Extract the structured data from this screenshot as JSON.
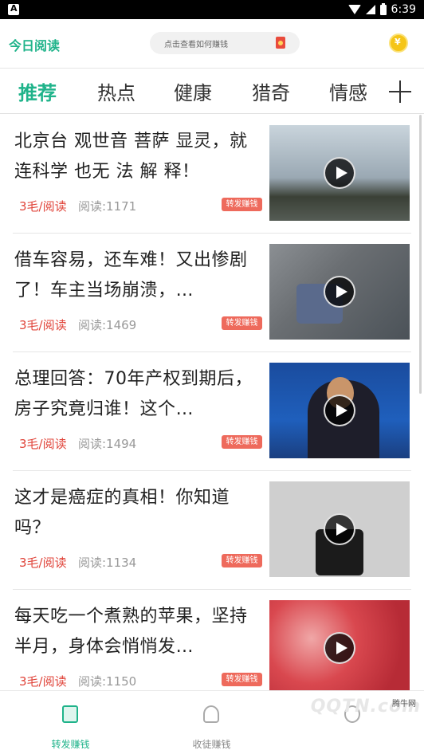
{
  "status_bar": {
    "time": "6:39"
  },
  "header": {
    "app_title": "今日阅读",
    "search_placeholder": "点击查看如何赚钱"
  },
  "tabs": [
    {
      "label": "推荐",
      "active": true
    },
    {
      "label": "热点",
      "active": false
    },
    {
      "label": "健康",
      "active": false
    },
    {
      "label": "猎奇",
      "active": false
    },
    {
      "label": "情感",
      "active": false
    }
  ],
  "feed": {
    "items": [
      {
        "title": "北京台 观世音 菩萨 显灵，就连科学 也无 法 解 释！",
        "reward": "3毛/阅读",
        "reads": "阅读:1171",
        "badge": "转发赚钱"
      },
      {
        "title": "借车容易，还车难！又出惨剧了！车主当场崩溃，…",
        "reward": "3毛/阅读",
        "reads": "阅读:1469",
        "badge": "转发赚钱"
      },
      {
        "title": "总理回答：70年产权到期后，房子究竟归谁！这个…",
        "reward": "3毛/阅读",
        "reads": "阅读:1494",
        "badge": "转发赚钱"
      },
      {
        "title": "这才是癌症的真相！你知道吗？",
        "reward": "3毛/阅读",
        "reads": "阅读:1134",
        "badge": "转发赚钱"
      },
      {
        "title": "每天吃一个煮熟的苹果，坚持半月，身体会悄悄发…",
        "reward": "3毛/阅读",
        "reads": "阅读:1150",
        "badge": "转发赚钱"
      }
    ]
  },
  "bottom_nav": [
    {
      "label": "转发赚钱",
      "active": true,
      "icon": "document-icon"
    },
    {
      "label": "收徒赚钱",
      "active": false,
      "icon": "people-icon"
    },
    {
      "label": "",
      "active": false,
      "icon": "person-icon"
    }
  ],
  "watermark": {
    "text": "QQTN.com",
    "small": "腾牛网"
  },
  "colors": {
    "accent": "#1fb38a",
    "reward": "#e0443a",
    "badge": "#ee6a5c"
  }
}
